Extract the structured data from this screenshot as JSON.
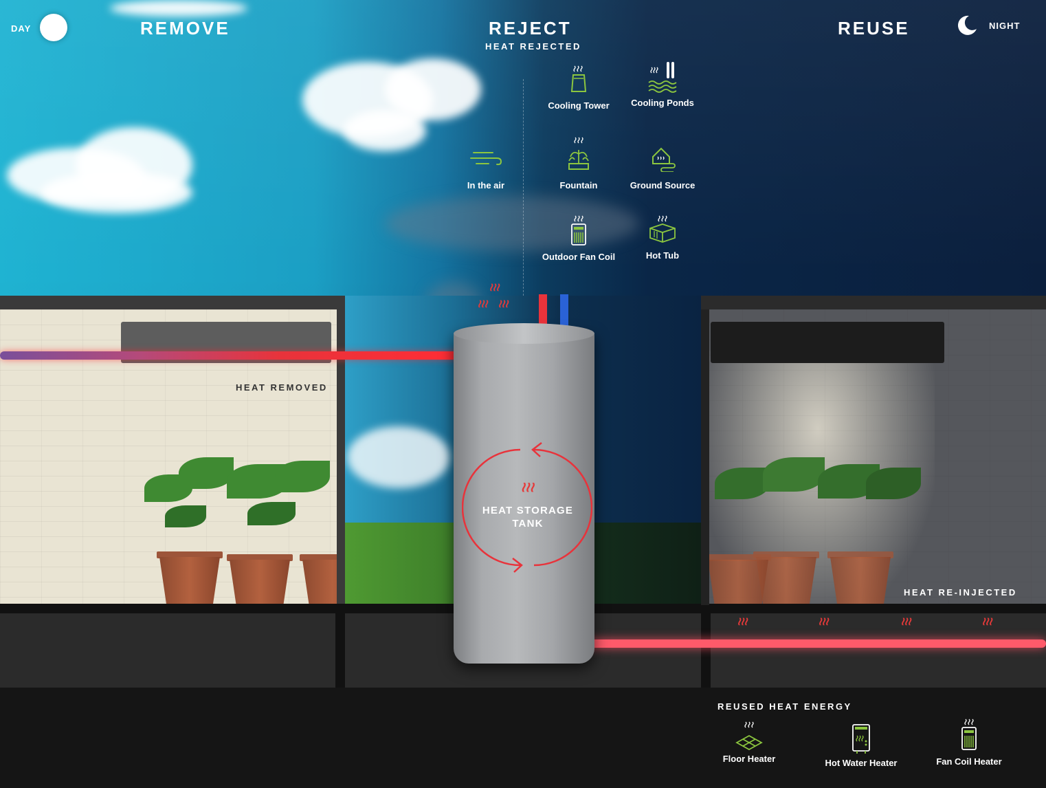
{
  "header": {
    "day_label": "DAY",
    "night_label": "NIGHT",
    "remove": "REMOVE",
    "reject": "REJECT",
    "reject_sub": "HEAT REJECTED",
    "reuse": "REUSE"
  },
  "reject_options": [
    {
      "label": "Cooling Tower",
      "icon": "cooling-tower-icon"
    },
    {
      "label": "Cooling Ponds",
      "icon": "cooling-ponds-icon"
    },
    {
      "label": "In the air",
      "icon": "air-icon"
    },
    {
      "label": "Fountain",
      "icon": "fountain-icon"
    },
    {
      "label": "Ground Source",
      "icon": "ground-source-icon"
    },
    {
      "label": "Outdoor Fan Coil",
      "icon": "fan-coil-icon"
    },
    {
      "label": "Hot Tub",
      "icon": "hot-tub-icon"
    }
  ],
  "scene": {
    "heat_removed": "HEAT REMOVED",
    "heat_reinjected": "HEAT RE-INJECTED",
    "tank_label_line1": "HEAT STORAGE",
    "tank_label_line2": "TANK"
  },
  "reuse_section": {
    "title": "REUSED HEAT ENERGY",
    "items": [
      {
        "label": "Floor Heater",
        "icon": "floor-heater-icon"
      },
      {
        "label": "Hot Water Heater",
        "icon": "hot-water-heater-icon"
      },
      {
        "label": "Fan Coil Heater",
        "icon": "fan-coil-heater-icon"
      }
    ]
  },
  "colors": {
    "accent_green": "#8cc63f",
    "heat_red": "#e8333b",
    "cold_blue": "#2a62d6"
  }
}
